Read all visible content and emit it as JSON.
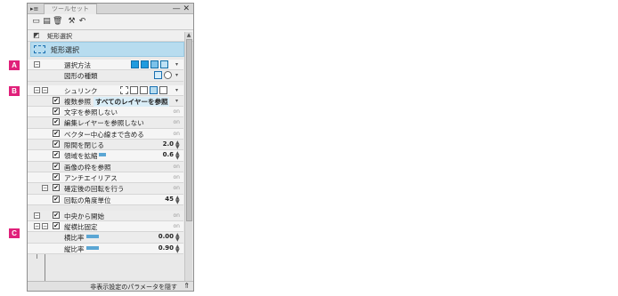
{
  "callouts": [
    "A",
    "B",
    "C"
  ],
  "panel": {
    "tab_label": "ツールセット",
    "title_buttons": "— ✕",
    "subtool_label": "矩形選択",
    "current_tool_label": "矩形選択",
    "footer_label": "非表示設定のパラメータを隠す"
  },
  "rows": [
    {
      "label": "選択方法",
      "kind": "icons"
    },
    {
      "label": "図形の種類",
      "kind": "shape"
    },
    {
      "label": "シュリンク",
      "kind": "icons2"
    },
    {
      "label": "複数参照",
      "value_text": "すべてのレイヤーを参照"
    },
    {
      "label": "文字を参照しない",
      "status": "on"
    },
    {
      "label": "編集レイヤーを参照しない",
      "status": "on"
    },
    {
      "label": "ベクター中心線まで含める",
      "status": "on"
    },
    {
      "label": "隙間を閉じる",
      "value": "2.0"
    },
    {
      "label": "領域を拡縮",
      "value": "0.6"
    },
    {
      "label": "画像の枠を参照",
      "status": "on"
    },
    {
      "label": "アンチエイリアス",
      "status": "on"
    },
    {
      "label": "確定後の回転を行う",
      "status": "on"
    },
    {
      "label": "回転の角度単位",
      "value": "45"
    },
    {
      "label": "中央から開始",
      "status": "on"
    },
    {
      "label": "縦横比固定",
      "status": "on"
    },
    {
      "label": "横比率",
      "value": "0.00"
    },
    {
      "label": "縦比率",
      "value": "0.90"
    }
  ]
}
